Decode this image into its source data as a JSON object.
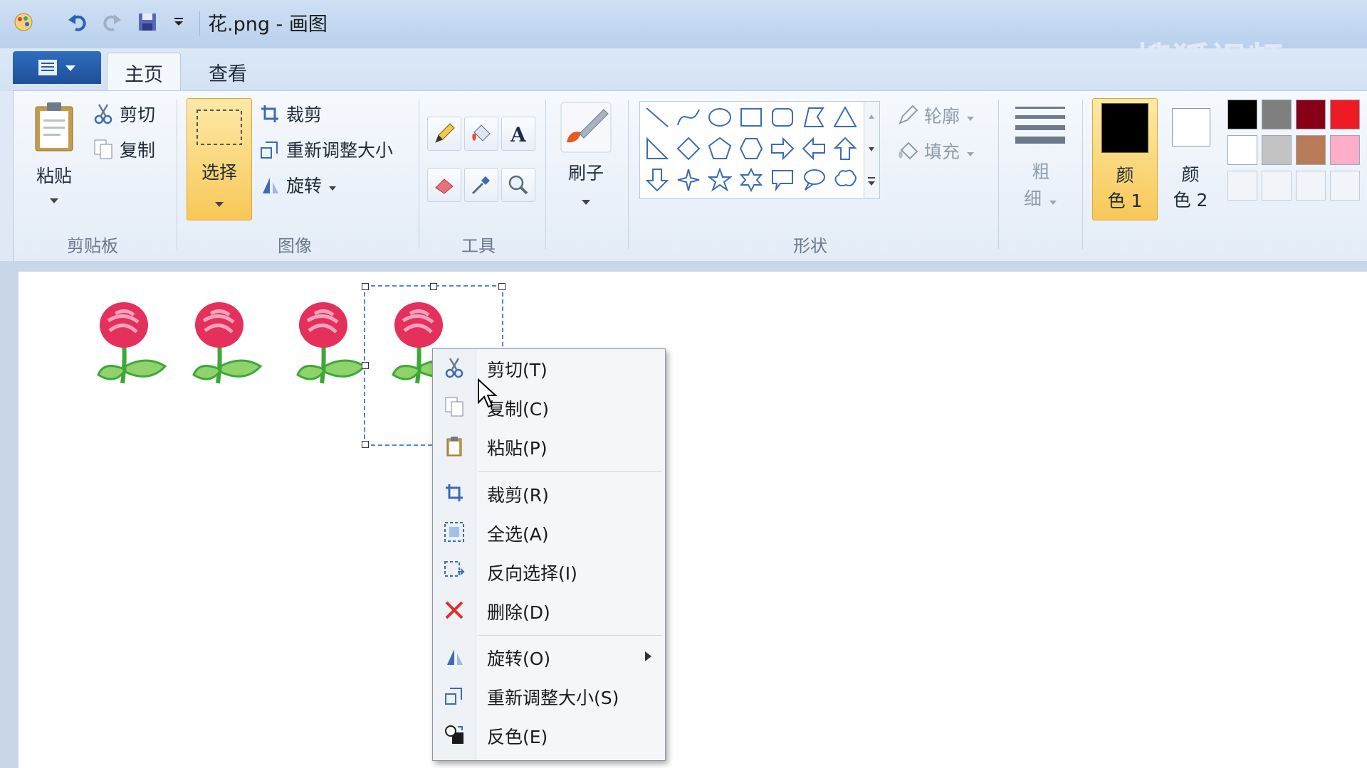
{
  "window": {
    "title": "花.png - 画图"
  },
  "tabs": [
    {
      "label": "主页"
    },
    {
      "label": "查看"
    }
  ],
  "clipboard": {
    "paste_label": "粘贴",
    "cut_label": "剪切",
    "copy_label": "复制",
    "group_label": "剪贴板"
  },
  "image": {
    "select_label": "选择",
    "crop_label": "裁剪",
    "resize_label": "重新调整大小",
    "rotate_label": "旋转",
    "group_label": "图像"
  },
  "tools": {
    "group_label": "工具"
  },
  "brushes": {
    "label": "刷子"
  },
  "shapes": {
    "outline_label": "轮廓",
    "fill_label": "填充",
    "group_label": "形状"
  },
  "size": {
    "label_top": "粗",
    "label_bottom": "细"
  },
  "colors": {
    "color1_top": "颜",
    "color1_bottom": "色 1",
    "color2_top": "颜",
    "color2_bottom": "色 2",
    "color1_value": "#000000",
    "color2_value": "#ffffff",
    "palette_row1": [
      "#000000",
      "#7f7f7f",
      "#880015",
      "#ed1c24"
    ],
    "palette_row2": [
      "#ffffff",
      "#c3c3c3",
      "#b97a57",
      "#ffaec9"
    ]
  },
  "context_menu": {
    "items": [
      {
        "label": "剪切(T)",
        "icon": "scissors-icon"
      },
      {
        "label": "复制(C)",
        "icon": "copy-icon"
      },
      {
        "label": "粘贴(P)",
        "icon": "paste-icon"
      },
      {
        "label": "裁剪(R)",
        "icon": "crop-icon"
      },
      {
        "label": "全选(A)",
        "icon": "select-all-icon"
      },
      {
        "label": "反向选择(I)",
        "icon": "invert-selection-icon"
      },
      {
        "label": "删除(D)",
        "icon": "delete-icon"
      },
      {
        "label": "旋转(O)",
        "icon": "rotate-icon"
      },
      {
        "label": "重新调整大小(S)",
        "icon": "resize-icon"
      },
      {
        "label": "反色(E)",
        "icon": "invert-color-icon"
      }
    ]
  },
  "watermark": {
    "text": "搜狐视频"
  }
}
